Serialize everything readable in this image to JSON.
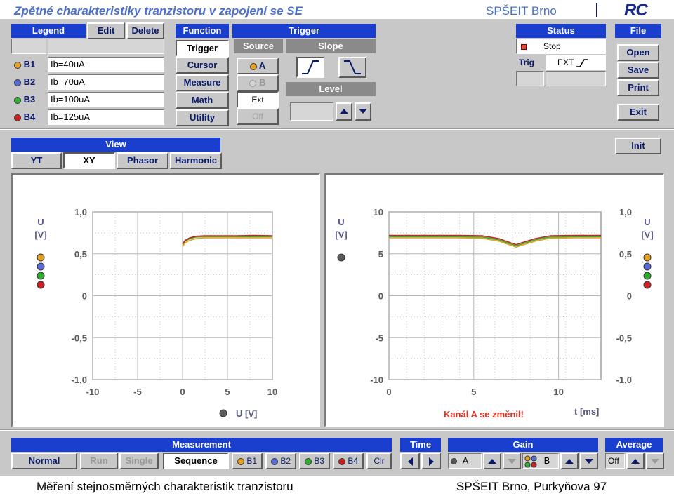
{
  "slide": {
    "title": "Zpětné charakteristiky tranzistoru v zapojení se SE",
    "school": "SPŠEIT Brno",
    "logo": "RC",
    "caption_left": "Měření stejnosměrných charakteristik tranzistoru",
    "caption_right": "SPŠEIT Brno, Purkyňova 97"
  },
  "legend": {
    "header": "Legend",
    "edit": "Edit",
    "delete": "Delete",
    "rows": [
      {
        "name": "B1",
        "desc": "Ib=40uA",
        "color": "#e8a020"
      },
      {
        "name": "B2",
        "desc": "Ib=70uA",
        "color": "#5a6ad8"
      },
      {
        "name": "B3",
        "desc": "Ib=100uA",
        "color": "#30b030"
      },
      {
        "name": "B4",
        "desc": "Ib=125uA",
        "color": "#d02020"
      }
    ]
  },
  "function": {
    "header": "Function",
    "items": [
      "Trigger",
      "Cursor",
      "Measure",
      "Math",
      "Utility"
    ],
    "active": "Trigger"
  },
  "trigger": {
    "header": "Trigger",
    "source_header": "Source",
    "slope_header": "Slope",
    "level_header": "Level",
    "source_a": "A",
    "source_b": "B",
    "ext": "Ext",
    "off": "Off"
  },
  "status": {
    "header": "Status",
    "state": "Stop",
    "trig_label": "Trig",
    "trig_value": "EXT"
  },
  "file": {
    "header": "File",
    "open": "Open",
    "save": "Save",
    "print": "Print",
    "exit": "Exit"
  },
  "view": {
    "header": "View",
    "tabs": [
      "YT",
      "XY",
      "Phasor",
      "Harmonic"
    ],
    "active": "XY",
    "init": "Init"
  },
  "plot_xy": {
    "y_unit_top": "U",
    "y_unit_bottom": "[V]",
    "x_label": "U [V]"
  },
  "plot_yt": {
    "y_unit_top": "U",
    "y_unit_bottom": "[V]",
    "x_label": "t [ms]",
    "message": "Kanál A se změnil!"
  },
  "measurement": {
    "header": "Measurement",
    "normal": "Normal",
    "run": "Run",
    "single": "Single",
    "sequence": "Sequence",
    "b1": "B1",
    "b2": "B2",
    "b3": "B3",
    "b4": "B4",
    "clr": "Clr"
  },
  "time": {
    "header": "Time"
  },
  "gain": {
    "header": "Gain",
    "a": "A",
    "b": "B"
  },
  "average": {
    "header": "Average",
    "value": "Off"
  },
  "chart_data": [
    {
      "type": "line",
      "name": "XY",
      "xlabel": "U [V]",
      "ylabel": "U [V]",
      "xlim": [
        -10,
        10
      ],
      "ylim": [
        -1.0,
        1.0
      ],
      "x_ticks": [
        "-10",
        "-5",
        "0",
        "5",
        "10"
      ],
      "y_ticks": [
        "1,0",
        "0,5",
        "0",
        "-0,5",
        "-1,0"
      ],
      "grid": true,
      "series": [
        {
          "color": "#e8a020",
          "x": [
            0,
            0.3,
            0.8,
            1.5,
            2.5,
            4,
            6,
            8,
            10
          ],
          "y": [
            0.59,
            0.63,
            0.66,
            0.68,
            0.69,
            0.69,
            0.69,
            0.69,
            0.69
          ]
        },
        {
          "color": "#30b030",
          "x": [
            0,
            0.3,
            0.8,
            1.5,
            2.5,
            4,
            6,
            8,
            10
          ],
          "y": [
            0.61,
            0.65,
            0.68,
            0.7,
            0.705,
            0.705,
            0.705,
            0.705,
            0.705
          ]
        },
        {
          "color": "#d02020",
          "x": [
            0,
            0.3,
            0.8,
            1.5,
            2.5,
            4,
            6,
            8,
            10
          ],
          "y": [
            0.62,
            0.66,
            0.69,
            0.71,
            0.715,
            0.715,
            0.715,
            0.72,
            0.715
          ]
        }
      ]
    },
    {
      "type": "line",
      "name": "YT",
      "xlabel": "t [ms]",
      "ylabel": "U [V]",
      "xlim": [
        0,
        12.5
      ],
      "ylim_left": [
        -10,
        10
      ],
      "ylim_right": [
        -1.0,
        1.0
      ],
      "x_ticks": [
        "0",
        "5",
        "10"
      ],
      "y_ticks_left": [
        "10",
        "5",
        "0",
        "-5",
        "-10"
      ],
      "y_ticks_right": [
        "1,0",
        "0,5",
        "0",
        "-0,5",
        "-1,0"
      ],
      "grid": true,
      "series": [
        {
          "color": "#e8a020",
          "x": [
            0,
            4,
            5.5,
            6.5,
            7.2,
            7.5,
            7.8,
            8.6,
            9.5,
            11,
            12.5
          ],
          "y": [
            6.9,
            6.9,
            6.85,
            6.5,
            6.0,
            5.8,
            6.0,
            6.5,
            6.85,
            6.9,
            6.9
          ]
        },
        {
          "color": "#d02020",
          "x": [
            0,
            4,
            5.5,
            6.5,
            7.2,
            7.5,
            7.8,
            8.6,
            9.5,
            11,
            12.5
          ],
          "y": [
            7.2,
            7.2,
            7.15,
            6.8,
            6.3,
            6.1,
            6.3,
            6.8,
            7.15,
            7.2,
            7.2
          ]
        },
        {
          "color": "#30b030",
          "x": [
            0,
            4,
            5.5,
            6.5,
            7.2,
            7.5,
            7.8,
            8.6,
            9.5,
            11,
            12.5
          ],
          "y": [
            7.05,
            7.05,
            7.0,
            6.65,
            6.15,
            5.95,
            6.15,
            6.65,
            7.0,
            7.05,
            7.05
          ]
        }
      ]
    }
  ]
}
